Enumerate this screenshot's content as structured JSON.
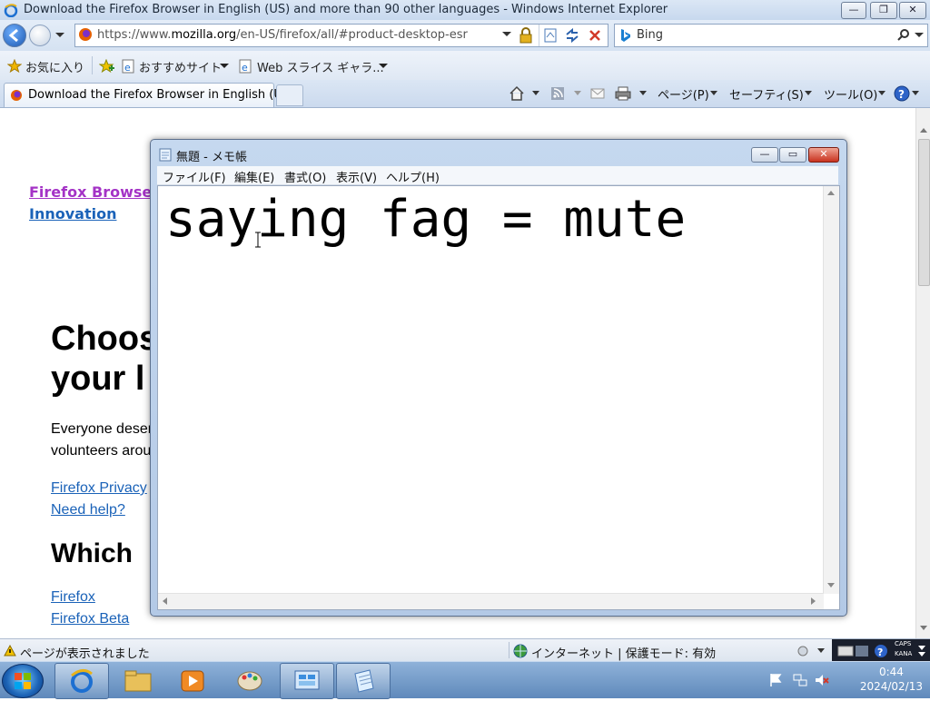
{
  "browser": {
    "window_title": "Download the Firefox Browser in English (US) and more than 90 other languages - Windows Internet Explorer",
    "address": {
      "url_prefix": "https://www.",
      "url_domain": "mozilla.org",
      "url_path": "/en-US/firefox/all/#product-desktop-esr"
    },
    "search_engine": "Bing",
    "favorites_label": "お気に入り",
    "favorites_bar_items": [
      "おすすめサイト",
      "Web スライス ギャラ..."
    ],
    "tab_label": "Download the Firefox Browser in English (U...",
    "commands": {
      "page": "ページ(P)",
      "safety": "セーフティ(S)",
      "tools": "ツール(O)"
    }
  },
  "page": {
    "nav_links": [
      "Firefox Browsers",
      "Innovation"
    ],
    "heading_1_line1": "Choos",
    "heading_1_line2": "your l",
    "body_line1": "Everyone deser",
    "body_line2": "volunteers arou",
    "links": [
      "Firefox Privacy",
      "Need help?"
    ],
    "heading_2": "Which",
    "product_links": [
      "Firefox",
      "Firefox Beta"
    ]
  },
  "notepad": {
    "title": "無題 - メモ帳",
    "menu": [
      "ファイル(F)",
      "編集(E)",
      "書式(O)",
      "表示(V)",
      "ヘルプ(H)"
    ],
    "content": "saying fag = mute"
  },
  "status_bar": {
    "message": "ページが表示されました",
    "zone": "インターネット | 保護モード: 有効"
  },
  "taskbar": {
    "time": "0:44",
    "date": "2024/02/13",
    "caps": "CAPS",
    "kana": "KANA"
  },
  "colors": {
    "link_blue": "#1a62b8",
    "link_visited": "#a433c6",
    "close_red": "#d23a2a"
  }
}
